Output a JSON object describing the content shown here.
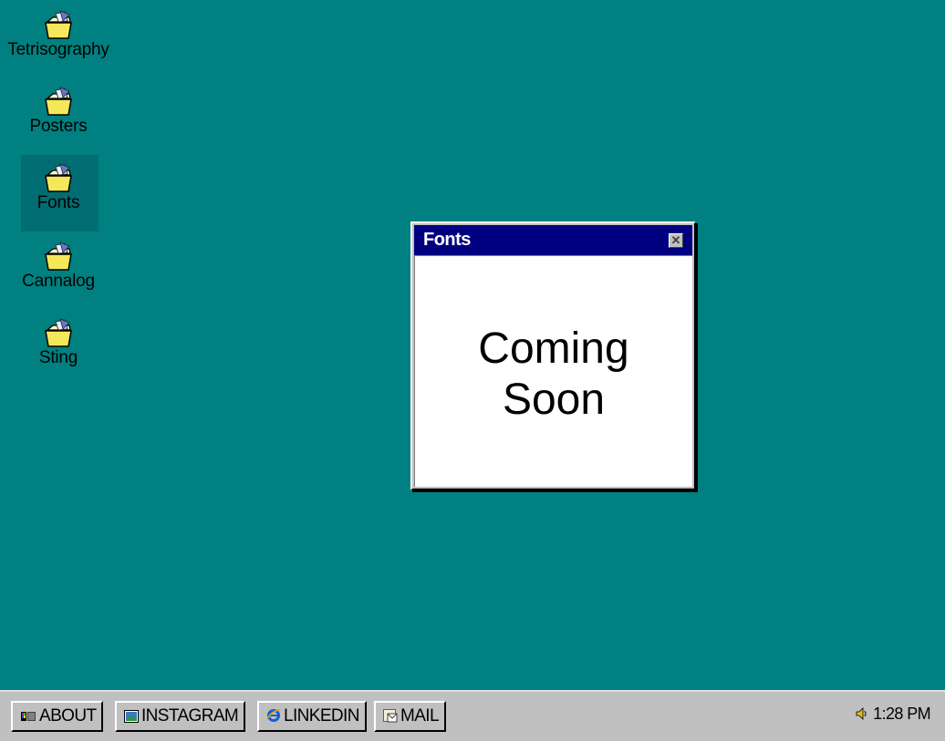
{
  "desktop": {
    "background": "#008080",
    "icons": [
      {
        "label": "Tetrisography",
        "icon": "folder-icon"
      },
      {
        "label": "Posters",
        "icon": "folder-icon"
      },
      {
        "label": "Fonts",
        "icon": "folder-icon",
        "selected": true
      },
      {
        "label": "Cannalog",
        "icon": "folder-icon"
      },
      {
        "label": "Sting",
        "icon": "folder-icon"
      }
    ]
  },
  "window": {
    "title": "Fonts",
    "message_line1": "Coming",
    "message_line2": "Soon",
    "titlebar_color": "#000080"
  },
  "taskbar": {
    "buttons": [
      {
        "label": "ABOUT",
        "icon": "about-icon"
      },
      {
        "label": "INSTAGRAM",
        "icon": "instagram-icon"
      },
      {
        "label": "LINKEDIN",
        "icon": "linkedin-icon"
      },
      {
        "label": "MAIL",
        "icon": "mail-icon"
      }
    ],
    "clock": "1:28 PM",
    "tray_icon": "speaker-icon"
  }
}
